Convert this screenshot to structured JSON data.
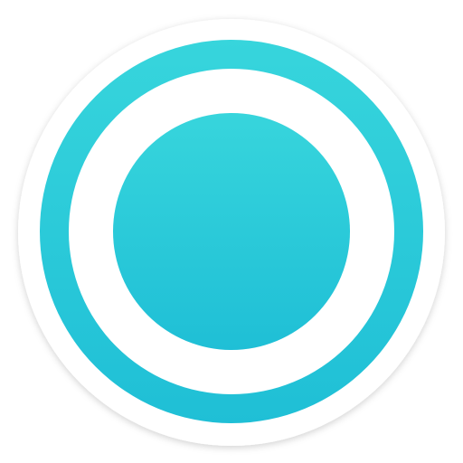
{
  "app_icon": {
    "icon_name": "record-icon",
    "colors": {
      "background": "#ffffff",
      "base_disc": "#ffffff",
      "accent_top": "#37d5dc",
      "accent_bottom": "#1fbfd6",
      "ring_gap": "#ffffff"
    }
  }
}
